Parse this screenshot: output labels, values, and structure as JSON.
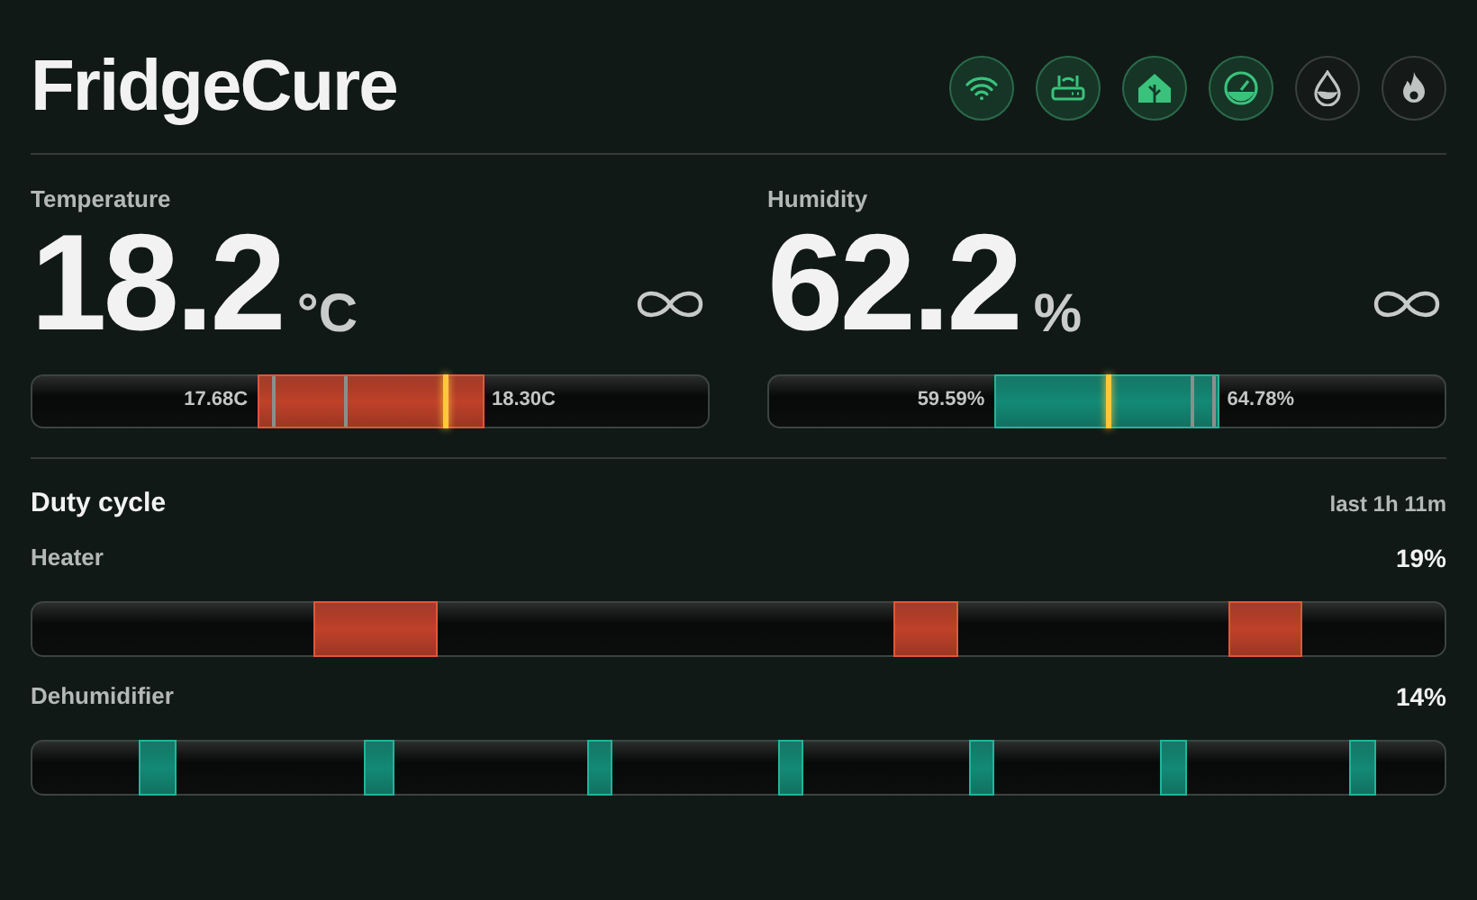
{
  "title": "FridgeCure",
  "status_icons": [
    {
      "kind": "wifi",
      "on": true
    },
    {
      "kind": "router",
      "on": true
    },
    {
      "kind": "home",
      "on": true
    },
    {
      "kind": "gauge",
      "on": true
    },
    {
      "kind": "drop",
      "on": false
    },
    {
      "kind": "flame",
      "on": false
    }
  ],
  "readings": [
    {
      "kind": "heat",
      "label": "Temperature",
      "value": "18.2",
      "unit": "°C",
      "range_low": "17.68C",
      "range_high": "18.30C",
      "level": 0.61
    },
    {
      "kind": "humid",
      "label": "Humidity",
      "value": "62.2",
      "unit": "%",
      "range_low": "59.59%",
      "range_high": "64.78%",
      "level": 0.5
    }
  ],
  "duty_cycle": {
    "title": "Duty cycle",
    "period": "last 1h 11m",
    "rows": [
      {
        "kind": "heat",
        "label": "Heater",
        "percent": "19%"
      },
      {
        "kind": "humid",
        "label": "Dehumidifier",
        "percent": "14%"
      }
    ]
  }
}
